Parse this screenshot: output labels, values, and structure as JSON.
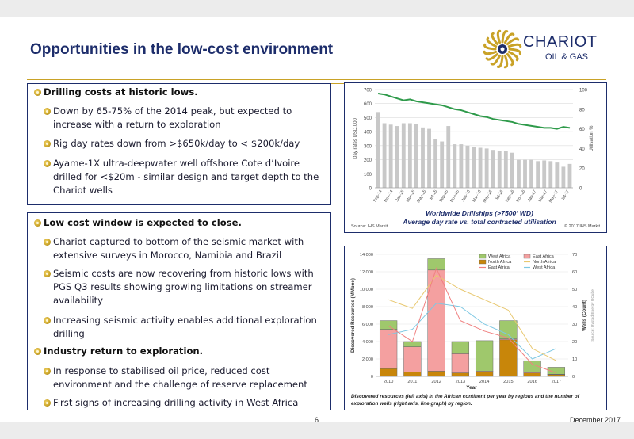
{
  "title": "Opportunities in the low-cost environment",
  "logo": {
    "name": "CHARIOT",
    "sub": "OIL & GAS"
  },
  "box1": {
    "heading": "Drilling costs at historic lows.",
    "bullets": [
      [
        "Down by 65-75% of the 2014 peak, but expected to",
        "increase with a return to exploration"
      ],
      [
        "Rig day rates down from >$650k/day to < $200k/day"
      ],
      [
        "Ayame-1X ultra-deepwater well offshore Cote d’Ivoire",
        "drilled for <$20m - similar design and target depth to the",
        "Chariot wells"
      ]
    ]
  },
  "box2": {
    "heading1": "Low cost window is expected to close.",
    "bullets1": [
      [
        "Chariot captured to bottom of the seismic market with",
        "extensive surveys in Morocco, Namibia and Brazil"
      ],
      [
        "Seismic costs are now recovering from historic lows with",
        "PGS Q3 results showing growing limitations on streamer",
        "availability"
      ],
      [
        "Increasing seismic activity enables additional exploration",
        "drilling"
      ]
    ],
    "heading2": "Industry return to exploration.",
    "bullets2": [
      [
        "In response to stabilised oil price, reduced cost",
        "environment and the challenge of reserve replacement"
      ],
      [
        "First signs of increasing drilling activity in West Africa"
      ]
    ]
  },
  "chart_data": [
    {
      "type": "bar",
      "title": "",
      "ylabel": "Day rates USD,000",
      "y2label": "Utilisation %",
      "ylim": [
        0,
        700
      ],
      "y2lim": [
        0,
        100
      ],
      "yticks": [
        "0",
        "100",
        "200",
        "300",
        "400",
        "500",
        "600",
        "700"
      ],
      "y2ticks": [
        "0",
        "20",
        "40",
        "60",
        "80",
        "100"
      ],
      "xticks": [
        "Sep-14",
        "Nov-14",
        "Jan-15",
        "Mar-15",
        "May-15",
        "Jul-15",
        "Sep-15",
        "Nov-15",
        "Jan-16",
        "Mar-16",
        "May-16",
        "Jul-16",
        "Sep-16",
        "Nov-16",
        "Jan-17",
        "Mar-17",
        "May-17",
        "Jul-17"
      ],
      "bars": [
        540,
        460,
        450,
        440,
        460,
        460,
        455,
        430,
        420,
        345,
        330,
        440,
        310,
        310,
        300,
        290,
        285,
        280,
        270,
        265,
        260,
        250,
        200,
        200,
        200,
        190,
        195,
        190,
        180,
        150,
        170
      ],
      "utilisation": [
        96,
        95,
        93,
        91,
        89,
        90,
        88,
        87,
        86,
        85,
        84,
        82,
        80,
        79,
        77,
        75,
        73,
        72,
        70,
        69,
        68,
        67,
        65,
        64,
        63,
        62,
        61,
        61,
        60,
        62,
        61
      ],
      "caption1": "Worldwide Drillships (>7500’ WD)",
      "caption2": "Average day rate vs. total contracted utilisation",
      "source_left": "Source: IHS Markit",
      "source_right": "© 2017 IHS Markit",
      "colors": {
        "bars": "#c8c8c8",
        "line": "#2e9a4a"
      }
    },
    {
      "type": "bar",
      "stacked": true,
      "ylabel": "Discovered Resources (MMboe)",
      "y2label": "Wells (Count)",
      "xlabel": "Year",
      "source_vertical": "Source: Rystad Energy UCube",
      "ylim": [
        0,
        14000
      ],
      "y2lim": [
        0,
        70
      ],
      "yticks": [
        "0",
        "2 000",
        "4 000",
        "6 000",
        "8 000",
        "10 000",
        "12 000",
        "14 000"
      ],
      "y2ticks": [
        "0",
        "10",
        "20",
        "30",
        "40",
        "50",
        "60",
        "70"
      ],
      "categories": [
        "2010",
        "2011",
        "2012",
        "2013",
        "2014",
        "2015",
        "2016",
        "2017"
      ],
      "series": [
        {
          "name": "North Africa",
          "color": "#c8860a",
          "values": [
            900,
            500,
            600,
            400,
            500,
            4200,
            400,
            200
          ]
        },
        {
          "name": "East Africa",
          "color": "#f4a0a0",
          "values": [
            4500,
            2900,
            11600,
            2200,
            100,
            100,
            100,
            50
          ]
        },
        {
          "name": "West Africa",
          "color": "#9fc86c",
          "values": [
            1000,
            600,
            1300,
            1400,
            3500,
            2100,
            1300,
            800
          ]
        }
      ],
      "lines": [
        {
          "name": "West Africa",
          "color": "#7ec8e3",
          "values": [
            24,
            27,
            42,
            40,
            30,
            24,
            10,
            16
          ]
        },
        {
          "name": "North Africa",
          "color": "#e8c870",
          "values": [
            44,
            39,
            58,
            50,
            44,
            38,
            16,
            9
          ]
        },
        {
          "name": "East Africa",
          "color": "#f08080",
          "values": [
            29,
            20,
            62,
            32,
            26,
            22,
            7,
            2
          ]
        }
      ],
      "legend": [
        "West Africa",
        "East Africa",
        "North Africa",
        "North Africa",
        "East Africa",
        "West Africa"
      ],
      "caption": [
        "Discovered resources (left axis) in the African continent per year by regions and the number of",
        "exploration wells (right axis, line graph) by region."
      ]
    }
  ],
  "footer": {
    "page": "6",
    "date": "December 2017"
  }
}
